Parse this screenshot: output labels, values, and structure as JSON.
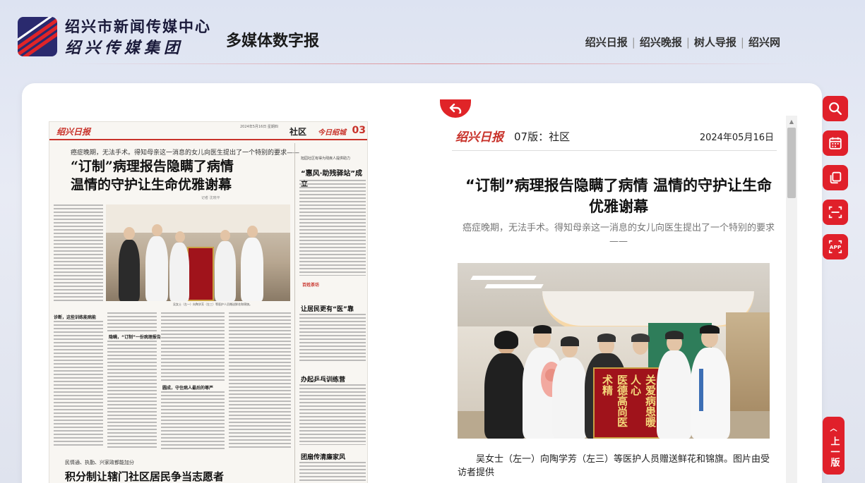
{
  "header": {
    "org_line1": "绍兴市新闻传媒中心",
    "org_line2": "绍兴传媒集团",
    "site_title": "多媒体数字报",
    "nav": [
      "绍兴日报",
      "绍兴晚报",
      "树人导报",
      "绍兴网"
    ]
  },
  "paper": {
    "brand": "绍兴日报",
    "date_text": "2024年5月16日 星期四",
    "section": "社区",
    "section_tag": "今日绍城",
    "page_num": "03",
    "lead": "癌症晚期，无法手术。得知母亲这一消息的女儿向医生提出了一个特别的要求——",
    "headline_line1": "“订制”病理报告隐瞒了病情",
    "headline_line2": "温情的守护让生命优雅谢幕",
    "byline": "记者  沈晓平",
    "photo_caption": "吴女士（左一）向陶学芳（左三）等医护人员赠送鲜花和锦旗。",
    "sub1": "诊断，这些训练能病能",
    "sub2": "隐瞒，“订制”一份病理报告",
    "sub3": "圆成，守住病人最后的尊严",
    "right_lead": "旭园社区有得为残疾人提供助力",
    "right_title": "“惠风·助残驿站”成立",
    "tag1": "百姓茶坊",
    "rtitle1": "让居民更有“医”靠",
    "rtitle2": "办起乒乓训练营",
    "rtitle3": "团扇传清廉家风",
    "bottom_lead": "民情通、执勤、兴家政都能加分",
    "bottom_title": "积分制让辖门社区居民争当志愿者"
  },
  "article": {
    "brand": "绍兴日报",
    "page_label": "07版：社区",
    "date": "2024年05月16日",
    "title": "“订制”病理报告隐瞒了病情 温情的守护让生命优雅谢幕",
    "subtitle": "癌症晚期，无法手术。得知母亲这一消息的女儿向医生提出了一个特别的要求——",
    "banner_left": "医德高尚医术精",
    "banner_right": "关爱病患暖人心",
    "caption": "吴女士（左一）向陶学芳（左三）等医护人员赠送鲜花和锦旗。图片由受访者提供"
  },
  "tools": {
    "icons": [
      "search-icon",
      "calendar-icon",
      "copy-icon",
      "scan-icon",
      "app-icon"
    ],
    "app_label": "APP",
    "prev_label": "上一版"
  },
  "colors": {
    "accent": "#e0202a",
    "brand_red": "#c8322a"
  }
}
